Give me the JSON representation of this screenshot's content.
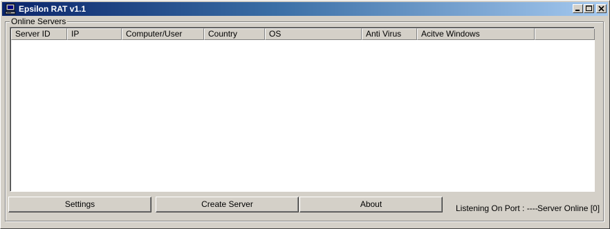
{
  "window": {
    "title": "Epsilon RAT v1.1",
    "icon": "computer-icon",
    "caption_buttons": [
      "minimize-icon",
      "maximize-icon",
      "close-icon"
    ]
  },
  "group": {
    "label": "Online Servers"
  },
  "table": {
    "columns": [
      "Server ID",
      "IP",
      "Computer/User",
      "Country",
      "OS",
      "Anti Virus",
      "Acitve Windows",
      ""
    ],
    "rows": []
  },
  "buttons": {
    "settings": "Settings",
    "create_server": "Create Server",
    "about": "About"
  },
  "status": {
    "listening": "Listening On Port : ----",
    "online": "Server Online [0]"
  },
  "colors": {
    "titlebar_start": "#0a246a",
    "titlebar_end": "#a6caf0",
    "face": "#d4d0c8",
    "list_background": "#ffffff"
  }
}
